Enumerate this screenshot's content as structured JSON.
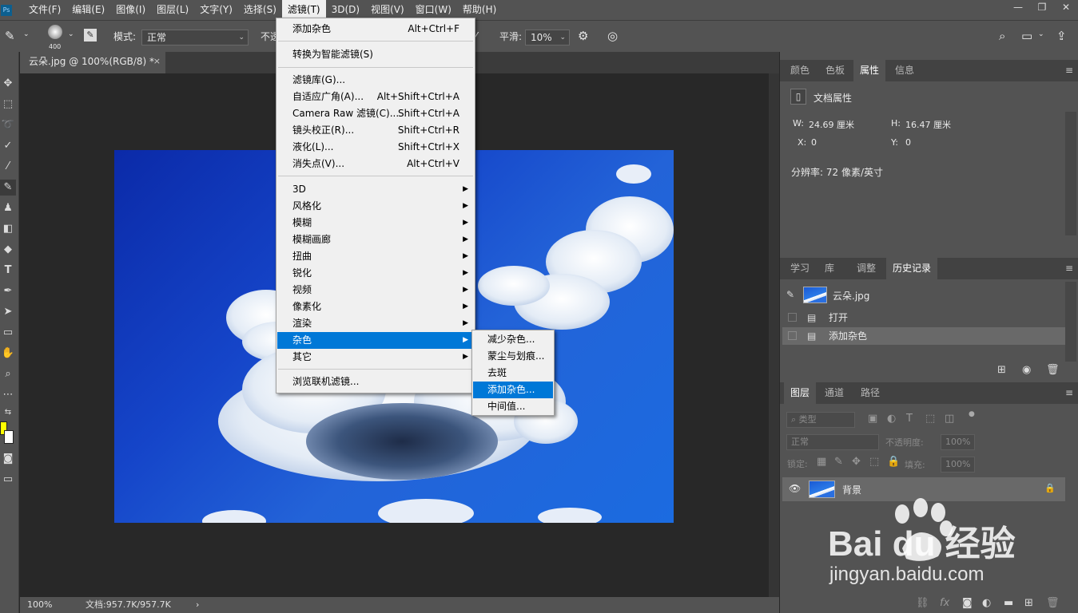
{
  "menubar": {
    "logo": "Ps",
    "items": [
      "文件(F)",
      "编辑(E)",
      "图像(I)",
      "图层(L)",
      "文字(Y)",
      "选择(S)",
      "滤镜(T)",
      "3D(D)",
      "视图(V)",
      "窗口(W)",
      "帮助(H)"
    ],
    "active_index": 6,
    "window_controls": [
      "—",
      "❐",
      "✕"
    ]
  },
  "options_bar": {
    "brush_size": "400",
    "mode_label": "模式:",
    "mode_value": "正常",
    "opacity_label": "不透",
    "smoothing_label": "平滑:",
    "smoothing_value": "10%"
  },
  "document_tab": {
    "title": "云朵.jpg @ 100%(RGB/8) *",
    "close": "×"
  },
  "statusbar": {
    "zoom": "100%",
    "doc_info": "文档:957.7K/957.7K",
    "arrow": "›"
  },
  "filter_menu": {
    "items": [
      {
        "label": "添加杂色",
        "shortcut": "Alt+Ctrl+F"
      },
      {
        "label": "转换为智能滤镜(S)",
        "shortcut": ""
      },
      {
        "label": "滤镜库(G)...",
        "shortcut": ""
      },
      {
        "label": "自适应广角(A)...",
        "shortcut": "Alt+Shift+Ctrl+A"
      },
      {
        "label": "Camera Raw 滤镜(C)...",
        "shortcut": "Shift+Ctrl+A"
      },
      {
        "label": "镜头校正(R)...",
        "shortcut": "Shift+Ctrl+R"
      },
      {
        "label": "液化(L)...",
        "shortcut": "Shift+Ctrl+X"
      },
      {
        "label": "消失点(V)...",
        "shortcut": "Alt+Ctrl+V"
      },
      {
        "label": "3D",
        "submenu": true
      },
      {
        "label": "风格化",
        "submenu": true
      },
      {
        "label": "模糊",
        "submenu": true
      },
      {
        "label": "模糊画廊",
        "submenu": true
      },
      {
        "label": "扭曲",
        "submenu": true
      },
      {
        "label": "锐化",
        "submenu": true
      },
      {
        "label": "视频",
        "submenu": true
      },
      {
        "label": "像素化",
        "submenu": true
      },
      {
        "label": "渲染",
        "submenu": true
      },
      {
        "label": "杂色",
        "submenu": true
      },
      {
        "label": "其它",
        "submenu": true
      },
      {
        "label": "浏览联机滤镜...",
        "shortcut": ""
      }
    ],
    "highlighted": "杂色"
  },
  "noise_submenu": {
    "items": [
      "减少杂色...",
      "蒙尘与划痕...",
      "去斑",
      "添加杂色...",
      "中间值..."
    ],
    "highlighted": "添加杂色..."
  },
  "properties_panel": {
    "tabs": [
      "颜色",
      "色板",
      "属性",
      "信息"
    ],
    "active_tab": "属性",
    "section_title": "文档属性",
    "w_label": "W:",
    "w_value": "24.69 厘米",
    "h_label": "H:",
    "h_value": "16.47 厘米",
    "x_label": "X:",
    "x_value": "0",
    "y_label": "Y:",
    "y_value": "0",
    "resolution": "分辨率: 72 像素/英寸"
  },
  "history_panel": {
    "tabs": [
      "学习",
      "库",
      "调整",
      "历史记录"
    ],
    "active_tab": "历史记录",
    "snapshot": "云朵.jpg",
    "states": [
      "打开",
      "添加杂色"
    ],
    "selected_state": "添加杂色"
  },
  "layers_panel": {
    "tabs": [
      "图层",
      "通道",
      "路径"
    ],
    "active_tab": "图层",
    "filter_kind": "类型",
    "blend_mode": "正常",
    "opacity_label": "不透明度:",
    "opacity_value": "100%",
    "lock_label": "锁定:",
    "fill_label": "填充:",
    "fill_value": "100%",
    "layers": [
      {
        "name": "背景",
        "visible": true,
        "locked": true
      }
    ]
  },
  "watermark": {
    "brand": "Bai du 经验",
    "url": "jingyan.baidu.com"
  }
}
